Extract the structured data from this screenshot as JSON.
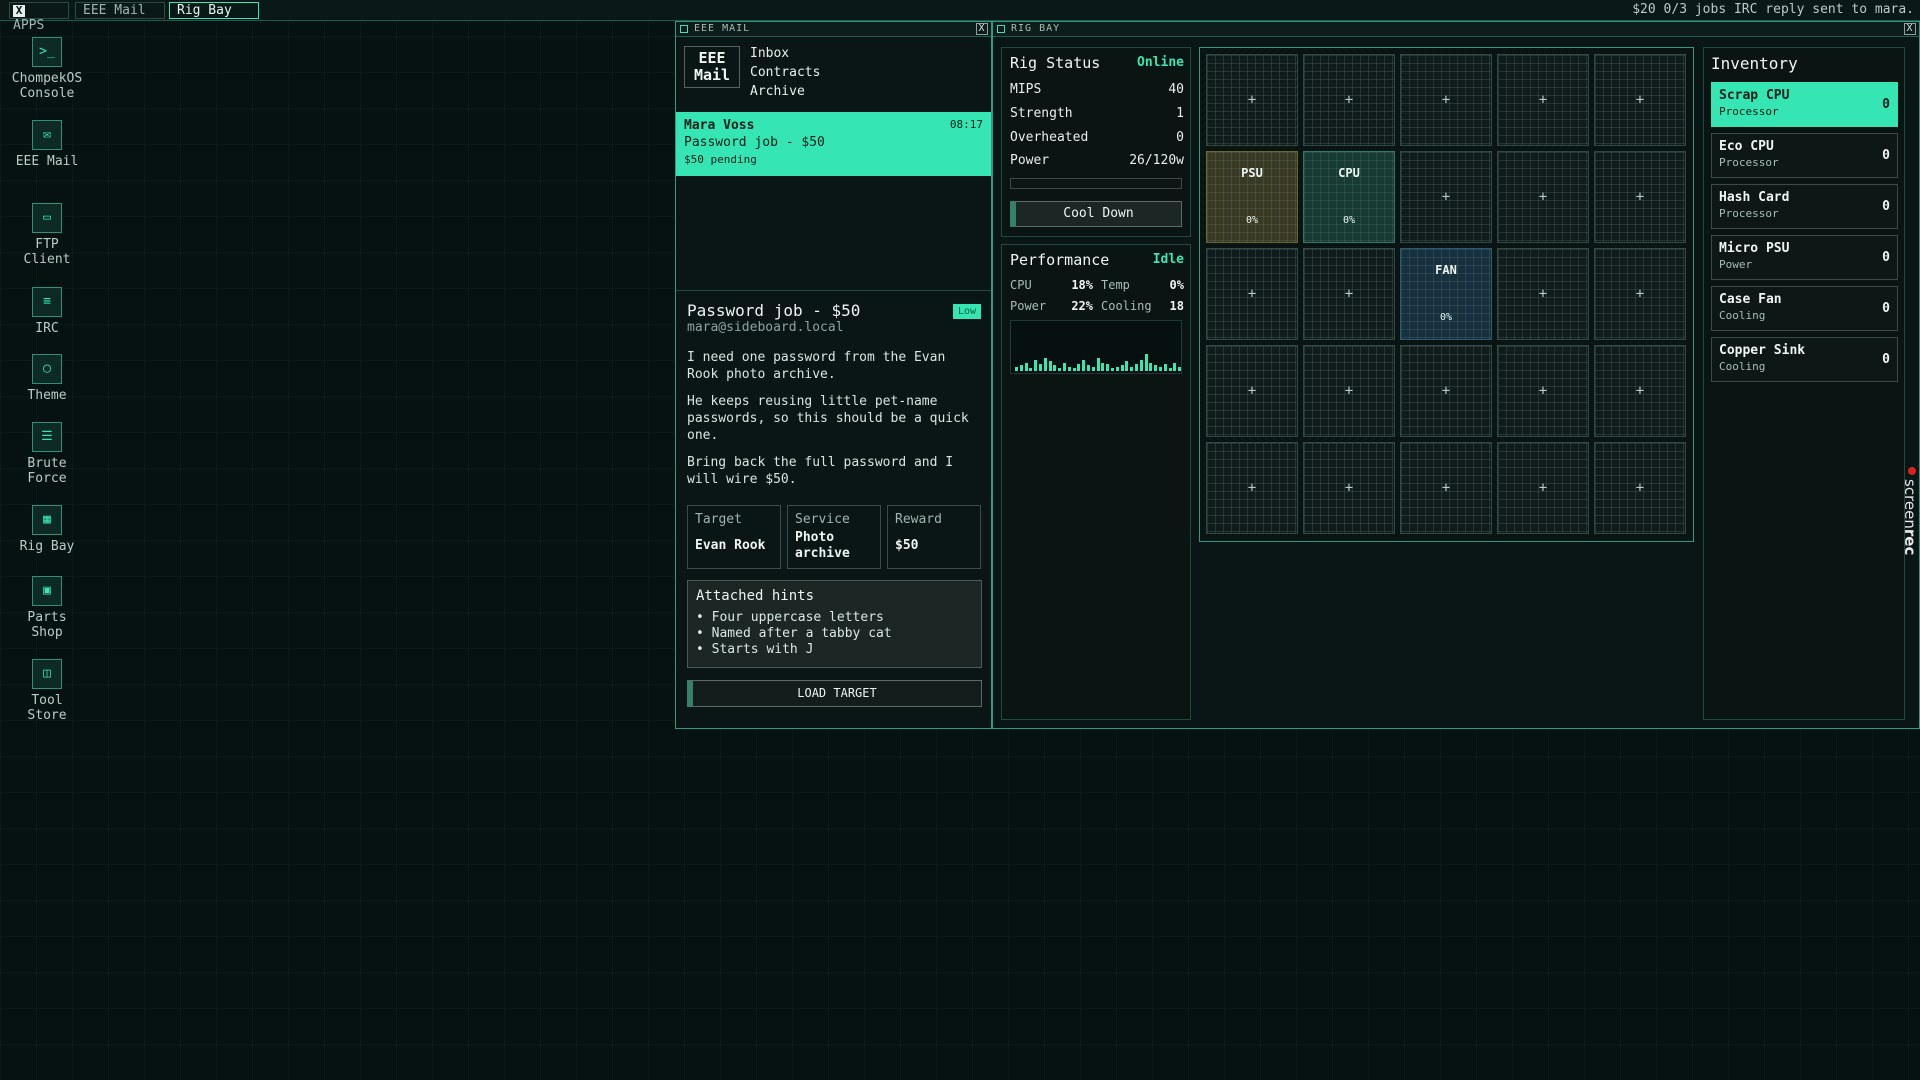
{
  "topbar": {
    "apps_icon": "X",
    "apps_label": "APPS",
    "tabs": [
      {
        "label": "EEE Mail"
      },
      {
        "label": "Rig Bay"
      }
    ],
    "status": "$20  0/3 jobs  IRC reply sent to mara."
  },
  "desktop": {
    "icons": [
      {
        "icon": "console-icon",
        "glyph": ">_",
        "label": "ChompekOS Console"
      },
      {
        "icon": "mail-icon",
        "glyph": "✉",
        "label": "EEE Mail"
      },
      {
        "icon": "ftp-icon",
        "glyph": "▭",
        "label": "FTP Client"
      },
      {
        "icon": "irc-icon",
        "glyph": "≡",
        "label": "IRC"
      },
      {
        "icon": "theme-icon",
        "glyph": "◯",
        "label": "Theme"
      },
      {
        "icon": "brute-force-icon",
        "glyph": "☰",
        "label": "Brute Force"
      },
      {
        "icon": "rig-bay-icon",
        "glyph": "▦",
        "label": "Rig Bay"
      },
      {
        "icon": "parts-shop-icon",
        "glyph": "▣",
        "label": "Parts Shop"
      },
      {
        "icon": "tool-store-icon",
        "glyph": "◫",
        "label": "Tool Store"
      }
    ]
  },
  "mail": {
    "window_title": "EEE MAIL",
    "close_glyph": "X",
    "logo_line1": "EEE",
    "logo_line2": "Mail",
    "nav": [
      "Inbox",
      "Contracts",
      "Archive"
    ],
    "selected": {
      "from": "Mara Voss",
      "time": "08:17",
      "subject": "Password job - $50",
      "status": "$50 pending"
    },
    "message": {
      "title": "Password job - $50",
      "priority": "Low",
      "address": "mara@sideboard.local",
      "paragraphs": [
        "I need one password from the Evan Rook photo archive.",
        "He keeps reusing little pet-name passwords, so this should be a quick one.",
        "Bring back the full password and I will wire $50."
      ],
      "meta": [
        {
          "key": "Target",
          "value": "Evan Rook"
        },
        {
          "key": "Service",
          "value": "Photo archive"
        },
        {
          "key": "Reward",
          "value": "$50"
        }
      ],
      "hints_title": "Attached hints",
      "hints": [
        "Four uppercase letters",
        "Named after a tabby cat",
        "Starts with J"
      ],
      "load_button": "LOAD TARGET"
    }
  },
  "rig": {
    "window_title": "RIG BAY",
    "close_glyph": "X",
    "status": {
      "title": "Rig Status",
      "state": "Online",
      "rows": [
        {
          "label": "MIPS",
          "value": "40"
        },
        {
          "label": "Strength",
          "value": "1"
        },
        {
          "label": "Overheated",
          "value": "0"
        },
        {
          "label": "Power",
          "value": "26/120w"
        }
      ],
      "power_fraction": 0.0,
      "cool_button": "Cool Down"
    },
    "performance": {
      "title": "Performance",
      "state": "Idle",
      "cpu_label": "CPU",
      "cpu_value": "18%",
      "temp_label": "Temp",
      "temp_value": "0%",
      "power_label": "Power",
      "power_value": "22%",
      "cooling_label": "Cooling",
      "cooling_value": "18",
      "history": [
        3,
        4,
        6,
        2,
        8,
        5,
        9,
        7,
        4,
        2,
        6,
        3,
        2,
        5,
        8,
        4,
        3,
        9,
        6,
        5,
        2,
        3,
        4,
        7,
        3,
        5,
        8,
        12,
        6,
        4,
        3,
        5,
        2,
        6,
        3
      ]
    },
    "slots": [
      "+",
      "+",
      "+",
      "+",
      "+",
      {
        "name": "PSU",
        "pct": "0%",
        "kind": "psu"
      },
      {
        "name": "CPU",
        "pct": "0%",
        "kind": "cpu"
      },
      "+",
      "+",
      "+",
      "+",
      "+",
      {
        "name": "FAN",
        "pct": "0%",
        "kind": "fan"
      },
      "+",
      "+",
      "+",
      "+",
      "+",
      "+",
      "+",
      "+",
      "+",
      "+",
      "+",
      "+"
    ],
    "inventory": {
      "title": "Inventory",
      "items": [
        {
          "name": "Scrap CPU",
          "category": "Processor",
          "qty": "0",
          "selected": true
        },
        {
          "name": "Eco CPU",
          "category": "Processor",
          "qty": "0"
        },
        {
          "name": "Hash Card",
          "category": "Processor",
          "qty": "0"
        },
        {
          "name": "Micro PSU",
          "category": "Power",
          "qty": "0"
        },
        {
          "name": "Case Fan",
          "category": "Cooling",
          "qty": "0"
        },
        {
          "name": "Copper Sink",
          "category": "Cooling",
          "qty": "0"
        }
      ]
    }
  },
  "overlay": {
    "watermark_a": "screen",
    "watermark_b": "rec"
  },
  "colors": {
    "accent": "#35e6b4",
    "background": "#061212",
    "border": "#2f9a82"
  }
}
